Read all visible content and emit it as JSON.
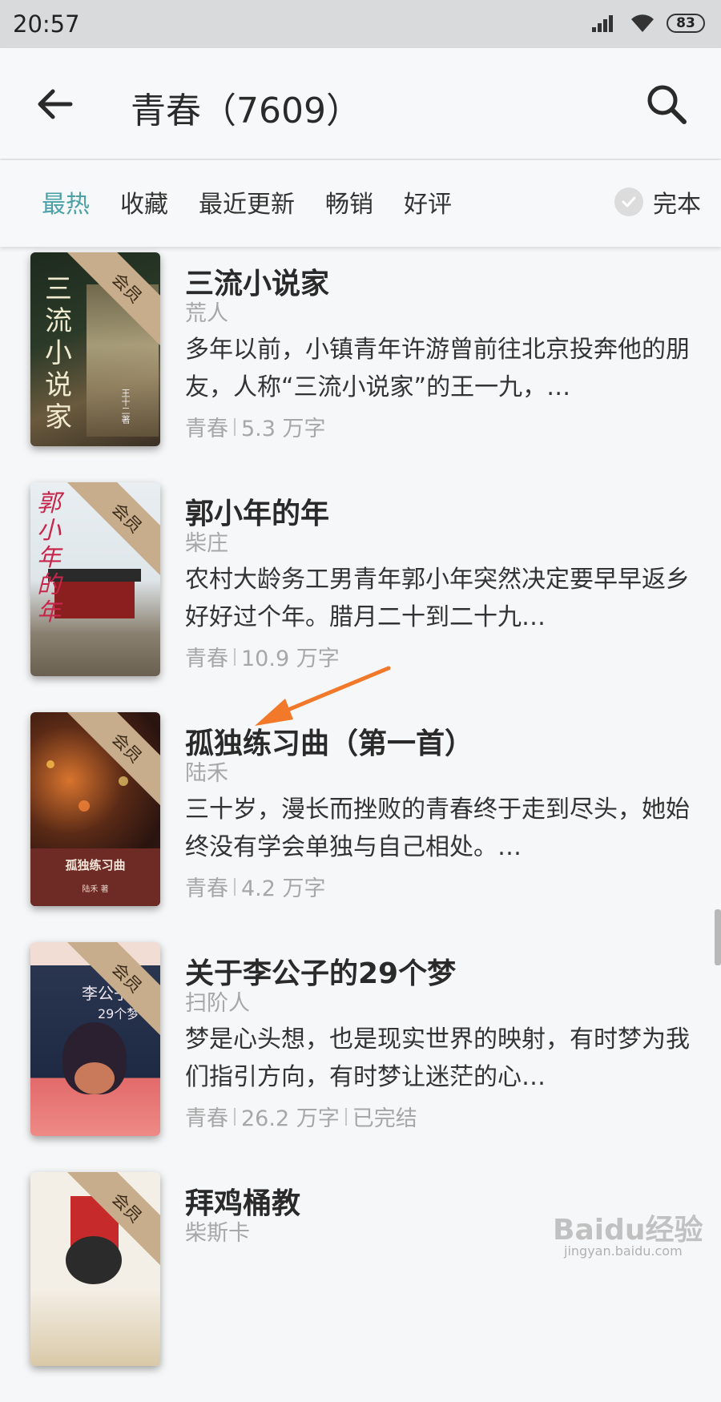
{
  "status_bar": {
    "time": "20:57",
    "battery": "83"
  },
  "header": {
    "title": "青春（7609）"
  },
  "filters": {
    "tabs": [
      {
        "label": "最热",
        "active": true
      },
      {
        "label": "收藏"
      },
      {
        "label": "最近更新"
      },
      {
        "label": "畅销"
      },
      {
        "label": "好评"
      }
    ],
    "complete_label": "完本"
  },
  "books": [
    {
      "title": "三流小说家",
      "author": "荒人",
      "description": "多年以前，小镇青年许游曾前往北京投奔他的朋友，人称“三流小说家”的王一九，…",
      "genre": "青春",
      "words": "5.3 万字",
      "badge": "会员",
      "cover_text": "三流小说家",
      "cover_sub": "王十二著"
    },
    {
      "title": "郭小年的年",
      "author": "柴庄",
      "description": "农村大龄务工男青年郭小年突然决定要早早返乡好好过个年。腊月二十到二十九…",
      "genre": "青春",
      "words": "10.9 万字",
      "badge": "会员",
      "cover_text": "郭小年的年"
    },
    {
      "title": "孤独练习曲（第一首）",
      "author": "陆禾",
      "description": "三十岁，漫长而挫败的青春终于走到尽头，她始终没有学会单独与自己相处。…",
      "genre": "青春",
      "words": "4.2 万字",
      "badge": "会员",
      "cover_text": "孤独练习曲",
      "cover_sub": "陆禾 著"
    },
    {
      "title": "关于李公子的29个梦",
      "author": "扫阶人",
      "description": "梦是心头想，也是现实世界的映射，有时梦为我们指引方向，有时梦让迷茫的心…",
      "genre": "青春",
      "words": "26.2 万字",
      "status": "已完结",
      "badge": "会员",
      "cover_text": "李公子",
      "cover_sub": "29个梦"
    },
    {
      "title": "拜鸡桶教",
      "author": "柴斯卡",
      "badge": "会员"
    }
  ],
  "watermark": {
    "text": "Baidu经验",
    "url": "jingyan.baidu.com"
  }
}
